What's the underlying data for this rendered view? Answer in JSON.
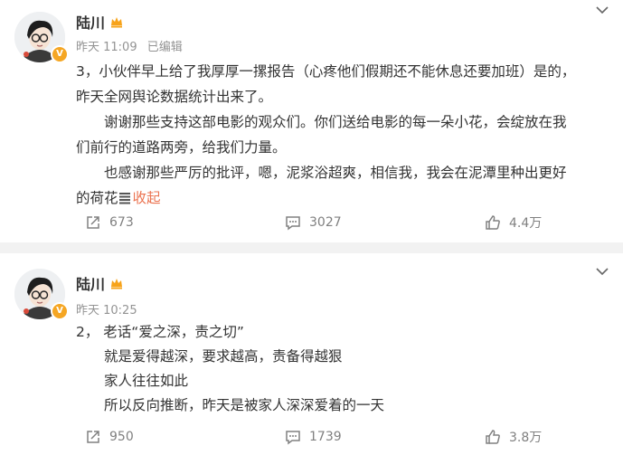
{
  "posts": [
    {
      "author": "陆川",
      "time": "昨天 11:09",
      "edited": "已编辑",
      "paragraphs": [
        "3，小伙伴早上给了我厚厚一摞报告（心疼他们假期还不能休息还要加班）是的，",
        "昨天全网舆论数据统计出来了。",
        "谢谢那些支持这部电影的观众们。你们送给电影的每一朵小花，会绽放在我",
        "们前行的道路两旁，给我们力量。",
        "也感谢那些严厉的批评，嗯，泥浆浴超爽，相信我，我会在泥潭里种出更好",
        "的荷花"
      ],
      "collapse": "收起",
      "reposts": "673",
      "comments": "3027",
      "likes": "4.4万"
    },
    {
      "author": "陆川",
      "time": "昨天 10:25",
      "paragraphs": [
        "2，  老话“爱之深，责之切”",
        "就是爱得越深，要求越高，责备得越狠",
        "家人往往如此",
        "所以反向推断，昨天是被家人深深爱着的一天"
      ],
      "reposts": "950",
      "comments": "1739",
      "likes": "3.8万"
    }
  ],
  "icons": {
    "avatar": "cartoon-avatar",
    "verified": "verified-v-badge",
    "vip": "vip-crown-icon",
    "more": "chevron-down-icon",
    "repost": "repost-icon",
    "comment": "comment-icon",
    "like": "like-icon"
  },
  "colors": {
    "accent": "#eb7350",
    "meta": "#939393",
    "action": "#808080",
    "separator": "#f2f2f2"
  }
}
